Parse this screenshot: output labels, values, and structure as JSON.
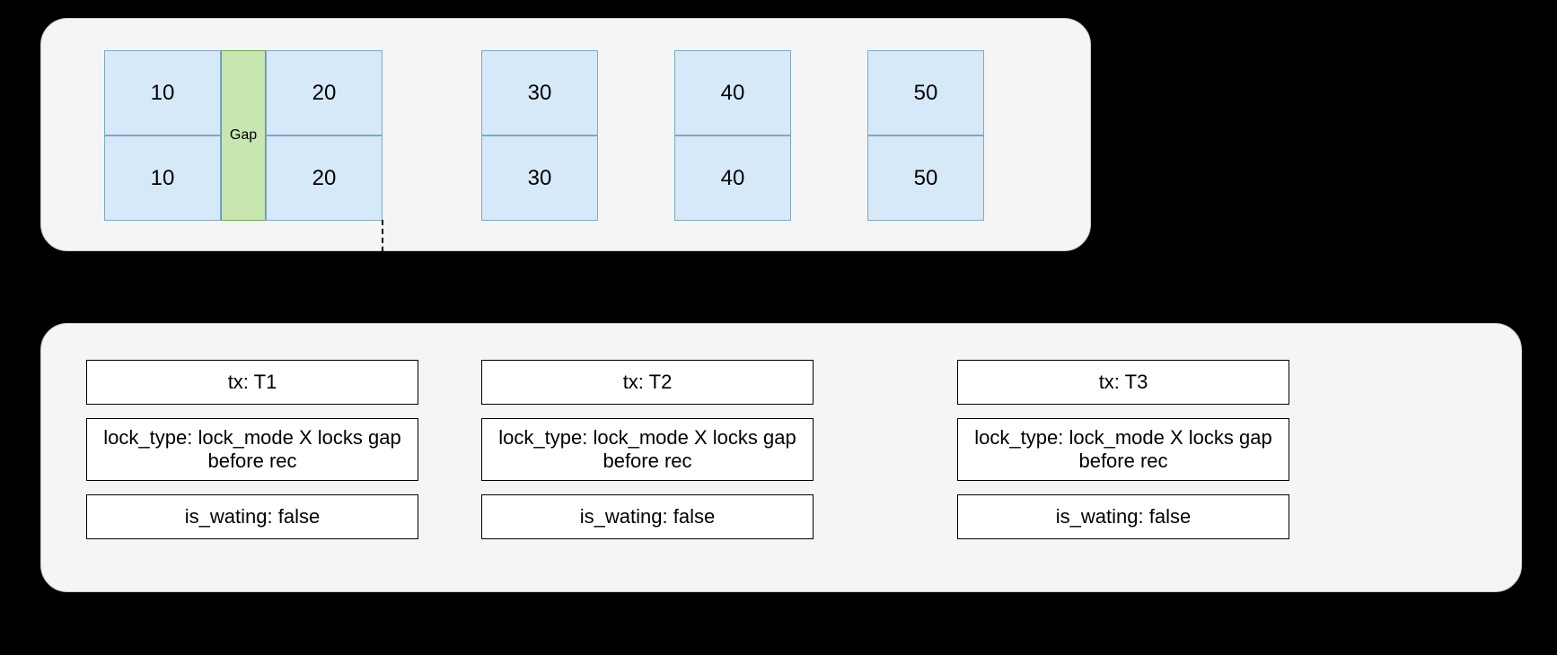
{
  "cells": {
    "c10a": "10",
    "c10b": "10",
    "c20a": "20",
    "c20b": "20",
    "c30a": "30",
    "c30b": "30",
    "c40a": "40",
    "c40b": "40",
    "c50a": "50",
    "c50b": "50",
    "gap": "Gap"
  },
  "locks": {
    "t1": {
      "tx": "tx: T1",
      "type": "lock_type: lock_mode X locks gap before rec",
      "waiting": "is_wating: false"
    },
    "t2": {
      "tx": "tx: T2",
      "type": "lock_type:  lock_mode X locks gap before rec",
      "waiting": "is_wating: false"
    },
    "t3": {
      "tx": "tx: T3",
      "type": "lock_type: lock_mode X locks gap before rec",
      "waiting": "is_wating: false"
    }
  }
}
